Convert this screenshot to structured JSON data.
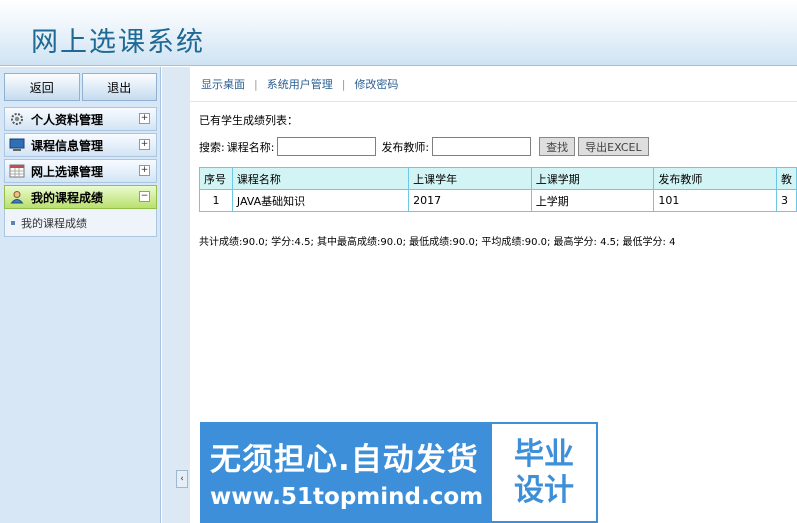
{
  "header": {
    "title": "网上选课系统"
  },
  "sidebar": {
    "buttons": {
      "back": "返回",
      "logout": "退出"
    },
    "items": [
      {
        "label": "个人资料管理",
        "icon": "gear-icon",
        "toggle": "+"
      },
      {
        "label": "课程信息管理",
        "icon": "monitor-icon",
        "toggle": "+"
      },
      {
        "label": "网上选课管理",
        "icon": "calendar-icon",
        "toggle": "+"
      },
      {
        "label": "我的课程成绩",
        "icon": "user-icon",
        "toggle": "−"
      }
    ],
    "sub_items": [
      {
        "label": "我的课程成绩"
      }
    ],
    "collapse_glyph": "‹"
  },
  "topnav": {
    "links": [
      "显示桌面",
      "系统用户管理",
      "修改密码"
    ],
    "separator": "|"
  },
  "main": {
    "list_title": "已有学生成绩列表：",
    "search": {
      "label": "搜索:",
      "course_label": "课程名称:",
      "teacher_label": "发布教师:",
      "course_value": "",
      "teacher_value": "",
      "find_button": "查找",
      "export_button": "导出EXCEL"
    },
    "table": {
      "headers": [
        "序号",
        "课程名称",
        "上课学年",
        "上课学期",
        "发布教师",
        "教"
      ],
      "rows": [
        [
          "1",
          "JAVA基础知识",
          "2017",
          "上学期",
          "101",
          "3"
        ]
      ]
    },
    "summary": "共计成绩:90.0; 学分:4.5; 其中最高成绩:90.0; 最低成绩:90.0; 平均成绩:90.0; 最高学分: 4.5; 最低学分: 4"
  },
  "watermark": {
    "line1": "无须担心.自动发货",
    "line2": "www.51topmind.com",
    "box_line1": "毕业",
    "box_line2": "设计"
  },
  "colors": {
    "header_title": "#1e6a94",
    "active_menu": "#b9e06e",
    "table_header": "#d2f4f4",
    "table_border": "#6fc7e6"
  }
}
